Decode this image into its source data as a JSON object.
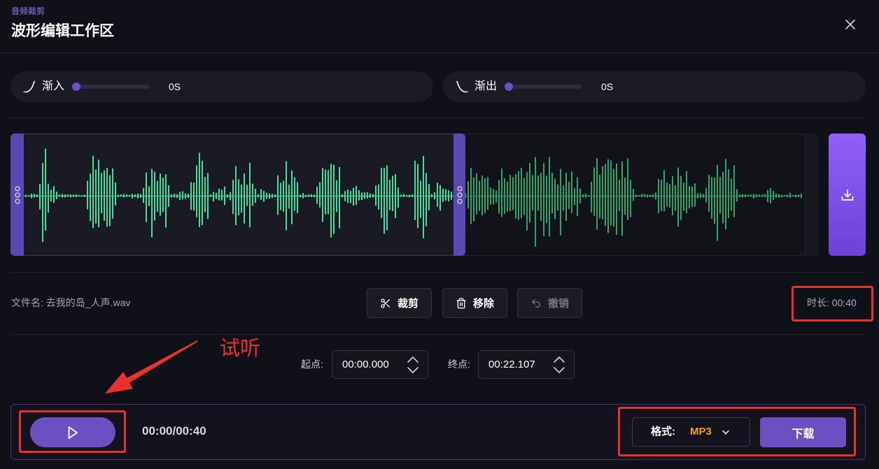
{
  "header": {
    "eyebrow": "音频裁剪",
    "title": "波形编辑工作区"
  },
  "fade_in": {
    "label": "渐入",
    "value": "0S",
    "level": 0
  },
  "fade_out": {
    "label": "渐出",
    "value": "0S",
    "level": 0
  },
  "file": {
    "label": "文件名:",
    "name": "去我的岛_人声.wav"
  },
  "actions": {
    "cut": "裁剪",
    "remove": "移除",
    "undo": "撤销"
  },
  "duration": {
    "label": "时长:",
    "value": "00:40"
  },
  "range": {
    "start": {
      "label": "起点:",
      "value": "00:00.000"
    },
    "end": {
      "label": "终点:",
      "value": "00:22.107"
    }
  },
  "player": {
    "time": "00:00/00:40"
  },
  "export": {
    "format_label": "格式:",
    "format_value": "MP3",
    "download_label": "下载"
  },
  "annotations": {
    "callout": "试听"
  },
  "icons": {
    "close": "close-icon",
    "fade_in": "fade-in-icon",
    "fade_out": "fade-out-icon",
    "download_selection": "download-icon",
    "cut": "scissors-icon",
    "remove": "trash-icon",
    "undo": "undo-icon",
    "play": "play-icon",
    "format_dropdown": "chevron-down-icon",
    "time_stepper": "stepper-icon",
    "selection_handle": "grip-dots-icon"
  },
  "colors": {
    "accent": "#6c4fc1",
    "accent_light": "#9160f7",
    "eyebrow": "#9b7bf5",
    "format_value": "#f5a01a",
    "annotation": "#e8322f",
    "waveform_selected": "#3fe09b",
    "waveform_unselected": "#2ea56c"
  }
}
